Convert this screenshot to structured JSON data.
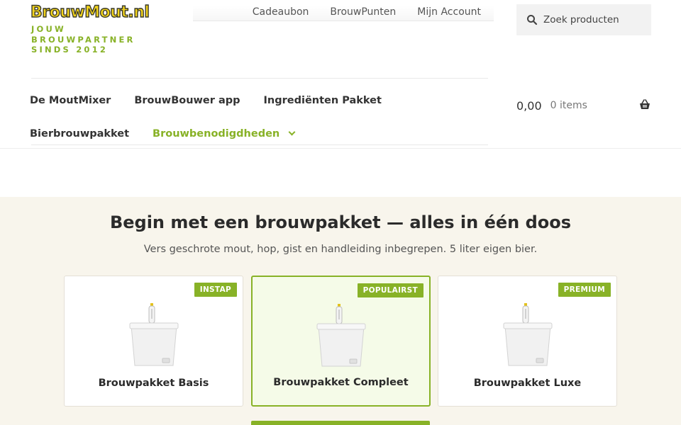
{
  "brand": {
    "logo_text": "BrouwMout.nl",
    "tagline": "Jouw brouwpartner sinds 2012"
  },
  "top_nav": [
    "Cadeaubon",
    "BrouwPunten",
    "Mijn Account"
  ],
  "search": {
    "placeholder": "Zoek producten",
    "icon": "search-icon"
  },
  "main_nav": {
    "row1": [
      "De MoutMixer",
      "BrouwBouwer app",
      "Ingrediënten Pakket"
    ],
    "row2": [
      "Bierbrouwpakket",
      "Brouwbenodigdheden"
    ],
    "active_item": "Brouwbenodigdheden"
  },
  "cart": {
    "amount": "0,00",
    "items": "0 items",
    "icon": "basket-icon"
  },
  "hero": {
    "title": "Begin met een brouwpakket — alles in één doos",
    "subtitle": "Vers geschrote mout, hop, gist en handleiding inbegrepen. 5 liter eigen bier."
  },
  "products": [
    {
      "badge": "INSTAP",
      "title": "Brouwpakket Basis",
      "featured": false
    },
    {
      "badge": "POPULAIRST",
      "title": "Brouwpakket Compleet",
      "featured": true
    },
    {
      "badge": "PREMIUM",
      "title": "Brouwpakket Luxe",
      "featured": false
    }
  ],
  "colors": {
    "accent": "#88b227",
    "logo_yellow": "#f3d41c",
    "hero_bg": "#f8f5ec"
  }
}
